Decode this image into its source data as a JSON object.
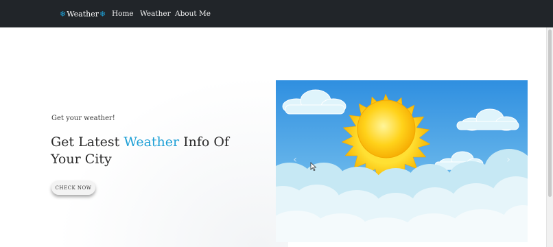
{
  "navbar": {
    "brand": "Weather",
    "brand_icon": "snowflake-icon",
    "links": [
      "Home",
      "Weather",
      "About Me"
    ]
  },
  "hero": {
    "eyebrow": "Get your weather!",
    "headline_before": "Get Latest ",
    "headline_accent": "Weather",
    "headline_after": " Info Of Your City",
    "cta": "CHECK NOW"
  },
  "carousel": {
    "image": "sun-and-clouds-illustration",
    "prev_icon": "chevron-left-icon",
    "next_icon": "chevron-right-icon"
  },
  "colors": {
    "navbar": "#212529",
    "accent": "#1ea0d6",
    "sky_top": "#2f8fe0",
    "sky_bottom": "#9fd3f1",
    "sun": "#ffd21a"
  }
}
